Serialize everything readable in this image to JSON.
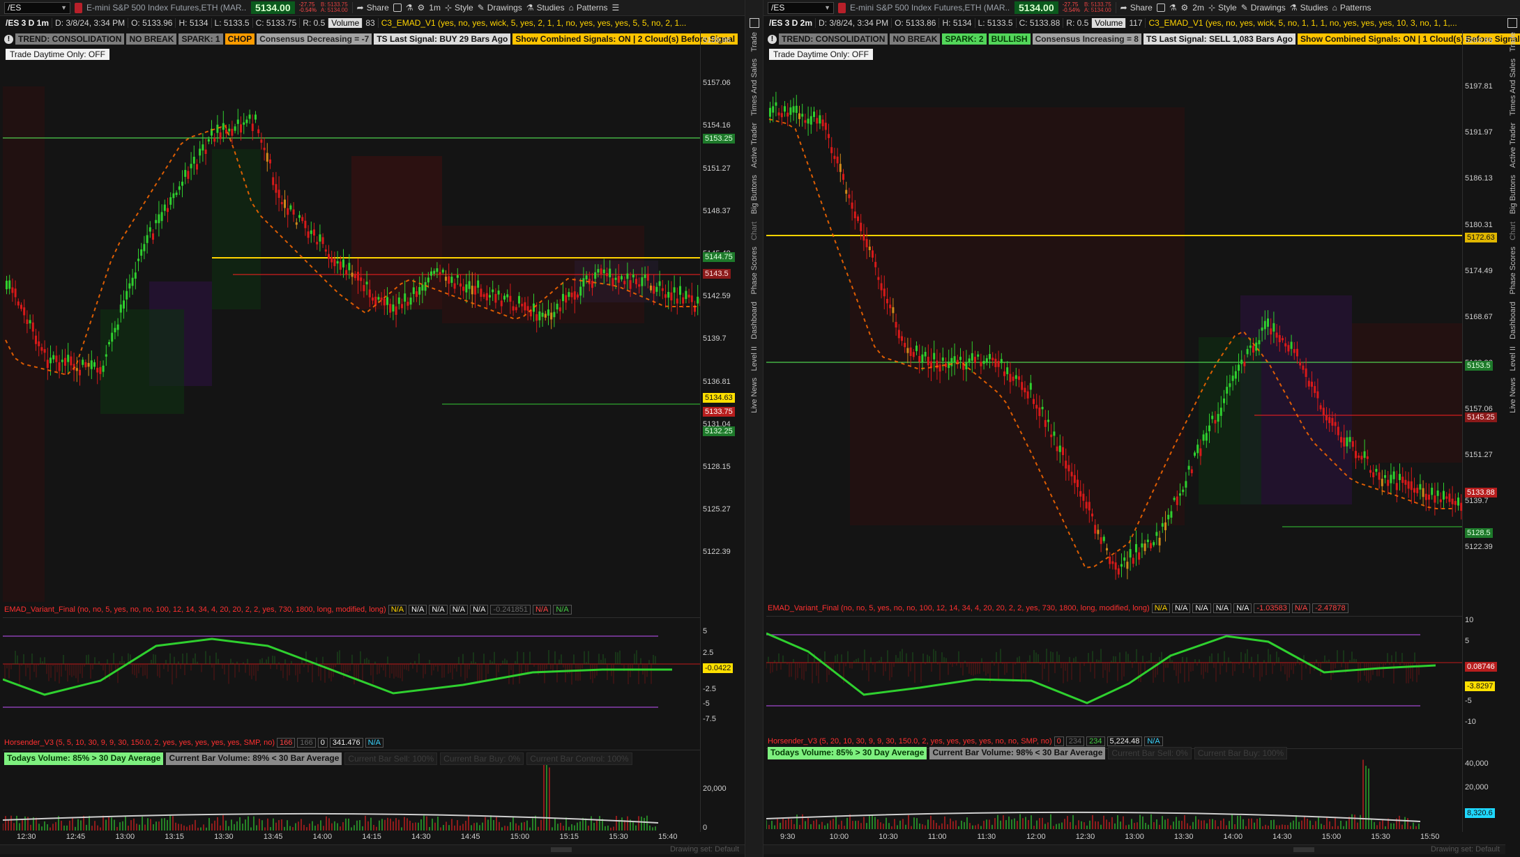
{
  "left": {
    "symbol": "/ES",
    "description": "E-mini S&P 500 Index Futures,ETH (MAR...",
    "last_price": "5134.00",
    "change": "-27.75",
    "change_pct": "-0.54%",
    "bid": "B: 5133.75",
    "ask": "A: 5134.00",
    "toolbar": {
      "share": "Share",
      "interval": "1m",
      "style": "Style",
      "drawings": "Drawings",
      "studies": "Studies",
      "patterns": "Patterns"
    },
    "info": {
      "period": "/ES 3 D 1m",
      "date": "D: 3/8/24, 3:34 PM",
      "open": "O: 5133.96",
      "high": "H: 5134",
      "low": "L: 5133.5",
      "close": "C: 5133.75",
      "range": "R: 0.5",
      "volume_label": "Volume",
      "volume": "83",
      "study": "C3_EMAD_V1 (yes, no, yes, wick, 5, yes, 2, 1, 1, no, yes, yes, yes, 5, 5, no, 2, 1..."
    },
    "badges": {
      "trend": "TREND: CONSOLIDATION",
      "nobreak": "NO BREAK",
      "spark": "SPARK: 1",
      "state": "CHOP",
      "consensus": "Consensus Decreasing = -7",
      "ts_signal": "TS Last Signal: BUY 29 Bars Ago",
      "combined": "Show Combined Signals: ON | 2 Cloud(s) Before Signal",
      "daytime": "Trade Daytime Only: OFF"
    },
    "price_ticks": [
      "5159.96",
      "5157.06",
      "5154.16",
      "5151.27",
      "5148.37",
      "5145.48",
      "5142.59",
      "5139.7",
      "5136.81",
      "5131.04",
      "5128.15",
      "5125.27",
      "5122.39"
    ],
    "price_tags": [
      {
        "label": "5153.25",
        "bg": "#1e7a2b",
        "fg": "#dfffdf"
      },
      {
        "label": "5144.75",
        "bg": "#1e7a2b",
        "fg": "#dfffdf"
      },
      {
        "label": "5143.5",
        "bg": "#8b1a1a",
        "fg": "#ffe0e0"
      },
      {
        "label": "5134.63",
        "bg": "#ffe000",
        "fg": "#111"
      },
      {
        "label": "5133.75",
        "bg": "#b81e1e",
        "fg": "#fff"
      },
      {
        "label": "5132.25",
        "bg": "#1e7a2b",
        "fg": "#dfffdf"
      }
    ],
    "emad": {
      "title": "EMAD_Variant_Final (no, no, 5, yes, no, no, 100, 12, 14, 34, 4, 20, 20, 2, 2, yes, 730, 1800, long, modified, long)",
      "vals": [
        "N/A",
        "N/A",
        "N/A",
        "N/A",
        "N/A",
        "-0.241851",
        "N/A",
        "N/A"
      ],
      "ticks": [
        "5",
        "2.5",
        "-2.5",
        "-5",
        "-7.5"
      ],
      "current": "-0.0422"
    },
    "hors": {
      "title": "Horsender_V3 (5, 5, 10, 30, 9, 9, 30, 150.0, 2, yes, yes, yes, yes, yes, SMP, no)",
      "v1": "166",
      "v2": "166",
      "v3": "0",
      "v4": "341.476",
      "v5": "N/A"
    },
    "volume_badges": {
      "today": "Todays Volume: 85% > 30 Day Average",
      "current": "Current Bar Volume: 89% < 30 Bar Average",
      "sell": "Current Bar Sell: 100%",
      "buy": "Current Bar Buy: 0%",
      "control": "Current Bar Control: 100%"
    },
    "vol_ticks": [
      "20,000",
      "0"
    ],
    "time_ticks": [
      "12:30",
      "12:45",
      "13:00",
      "13:15",
      "13:30",
      "13:45",
      "14:00",
      "14:15",
      "14:30",
      "14:45",
      "15:00",
      "15:15",
      "15:30",
      "15:40"
    ],
    "drawing_set": "Drawing set: Default"
  },
  "right": {
    "symbol": "/ES",
    "description": "E-mini S&P 500 Index Futures,ETH (MAR...",
    "last_price": "5134.00",
    "change": "-27.75",
    "change_pct": "-0.54%",
    "bid": "B: 5133.75",
    "ask": "A: 5134.00",
    "toolbar": {
      "share": "Share",
      "interval": "2m",
      "style": "Style",
      "drawings": "Drawings",
      "studies": "Studies",
      "patterns": "Patterns"
    },
    "info": {
      "period": "/ES 3 D 2m",
      "date": "D: 3/8/24, 3:34 PM",
      "open": "O: 5133.86",
      "high": "H: 5134",
      "low": "L: 5133.5",
      "close": "C: 5133.88",
      "range": "R: 0.5",
      "volume_label": "Volume",
      "volume": "117",
      "study": "C3_EMAD_V1 (yes, no, yes, wick, 5, no, 1, 1, 1, no, yes, yes, yes, 10, 3, no, 1, 1,..."
    },
    "badges": {
      "trend": "TREND: CONSOLIDATION",
      "nobreak": "NO BREAK",
      "spark": "SPARK: 2",
      "state": "BULLISH",
      "consensus": "Consensus Increasing = 8",
      "ts_signal": "TS Last Signal: SELL 1,083 Bars Ago",
      "combined": "Show Combined Signals: ON | 1 Cloud(s) Before Signal",
      "daytime": "Trade Daytime Only: OFF"
    },
    "price_ticks": [
      "5203.66",
      "5197.81",
      "5191.97",
      "5186.13",
      "5180.31",
      "5174.49",
      "5168.67",
      "5162.86",
      "5157.06",
      "5151.27",
      "5139.7",
      "5122.39"
    ],
    "price_tags": [
      {
        "label": "5172.63",
        "bg": "#e0b600",
        "fg": "#111"
      },
      {
        "label": "5153.5",
        "bg": "#1e7a2b",
        "fg": "#dfffdf"
      },
      {
        "label": "5145.25",
        "bg": "#8b1a1a",
        "fg": "#ffe0e0"
      },
      {
        "label": "5133.88",
        "bg": "#b81e1e",
        "fg": "#fff"
      },
      {
        "label": "5128.5",
        "bg": "#1e7a2b",
        "fg": "#dfffdf"
      }
    ],
    "emad": {
      "title": "EMAD_Variant_Final (no, no, 5, yes, no, no, 100, 12, 14, 34, 4, 20, 20, 2, 2, yes, 730, 1800, long, modified, long)",
      "vals": [
        "N/A",
        "N/A",
        "N/A",
        "N/A",
        "N/A",
        "-1.03583",
        "N/A",
        "-2.47878"
      ],
      "ticks": [
        "10",
        "5",
        "-5",
        "-10"
      ],
      "current": "0.08746",
      "current2": "-3.8297"
    },
    "hors": {
      "title": "Horsender_V3 (5, 20, 10, 30, 9, 9, 30, 150.0, 2, yes, yes, yes, yes, no, no, SMP, no)",
      "v1": "0",
      "v2": "234",
      "v3": "234",
      "v4": "5,224.48",
      "v5": "N/A"
    },
    "volume_badges": {
      "today": "Todays Volume: 85% > 30 Day Average",
      "current": "Current Bar Volume: 98% < 30 Bar Average",
      "sell": "Current Bar Sell: 0%",
      "buy": "Current Bar Buy: 100%"
    },
    "vol_ticks": [
      "40,000",
      "20,000",
      "8,320.6"
    ],
    "time_ticks": [
      "9:30",
      "10:00",
      "10:30",
      "11:00",
      "11:30",
      "12:00",
      "12:30",
      "13:00",
      "13:30",
      "14:00",
      "14:30",
      "15:00",
      "15:30",
      "15:50"
    ],
    "drawing_set": "Drawing set: Default"
  },
  "side_tabs": [
    "Trade",
    "Times And Sales",
    "Active Trader",
    "Big Buttons",
    "Chart",
    "Phase Scores",
    "Dashboard",
    "Level II",
    "Live News"
  ],
  "colors": {
    "up": "#33cc33",
    "down": "#e02020",
    "purple": "#8a3fb0",
    "orange": "#ff7a1a",
    "yellow": "#ffd400",
    "cloud_red": "#5a1010",
    "cloud_green": "#0f3a12"
  }
}
